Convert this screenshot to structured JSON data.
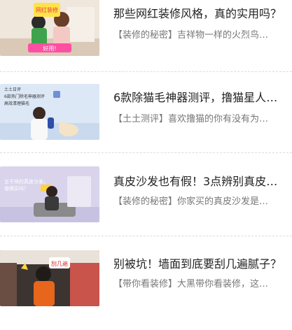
{
  "feed": {
    "items": [
      {
        "title": "那些网红装修风格，真的实用吗？",
        "desc": "【装修的秘密】吉祥物一样的火烈鸟…",
        "thumb_text": [
          "好用!",
          "网红装修"
        ]
      },
      {
        "title": "6款除猫毛神器测评，撸猫星人有…",
        "desc": "【土土测评】喜欢撸猫的你有没有为…",
        "thumb_text": [
          "土土日评",
          "6款热门除毛神器测评",
          "高效清理猫毛"
        ]
      },
      {
        "title": "真皮沙发也有假！3点辨别真皮沙…",
        "desc": "【装修的秘密】你家买的真皮沙发是…",
        "thumb_text": [
          "五千块的真皮沙发，",
          "值得买吗？"
        ]
      },
      {
        "title": "别被坑！墙面到底要刮几遍腻子？",
        "desc": "【带你看装修】大黑带你看装修，这…",
        "thumb_text": [
          "刮几遍"
        ]
      }
    ]
  }
}
